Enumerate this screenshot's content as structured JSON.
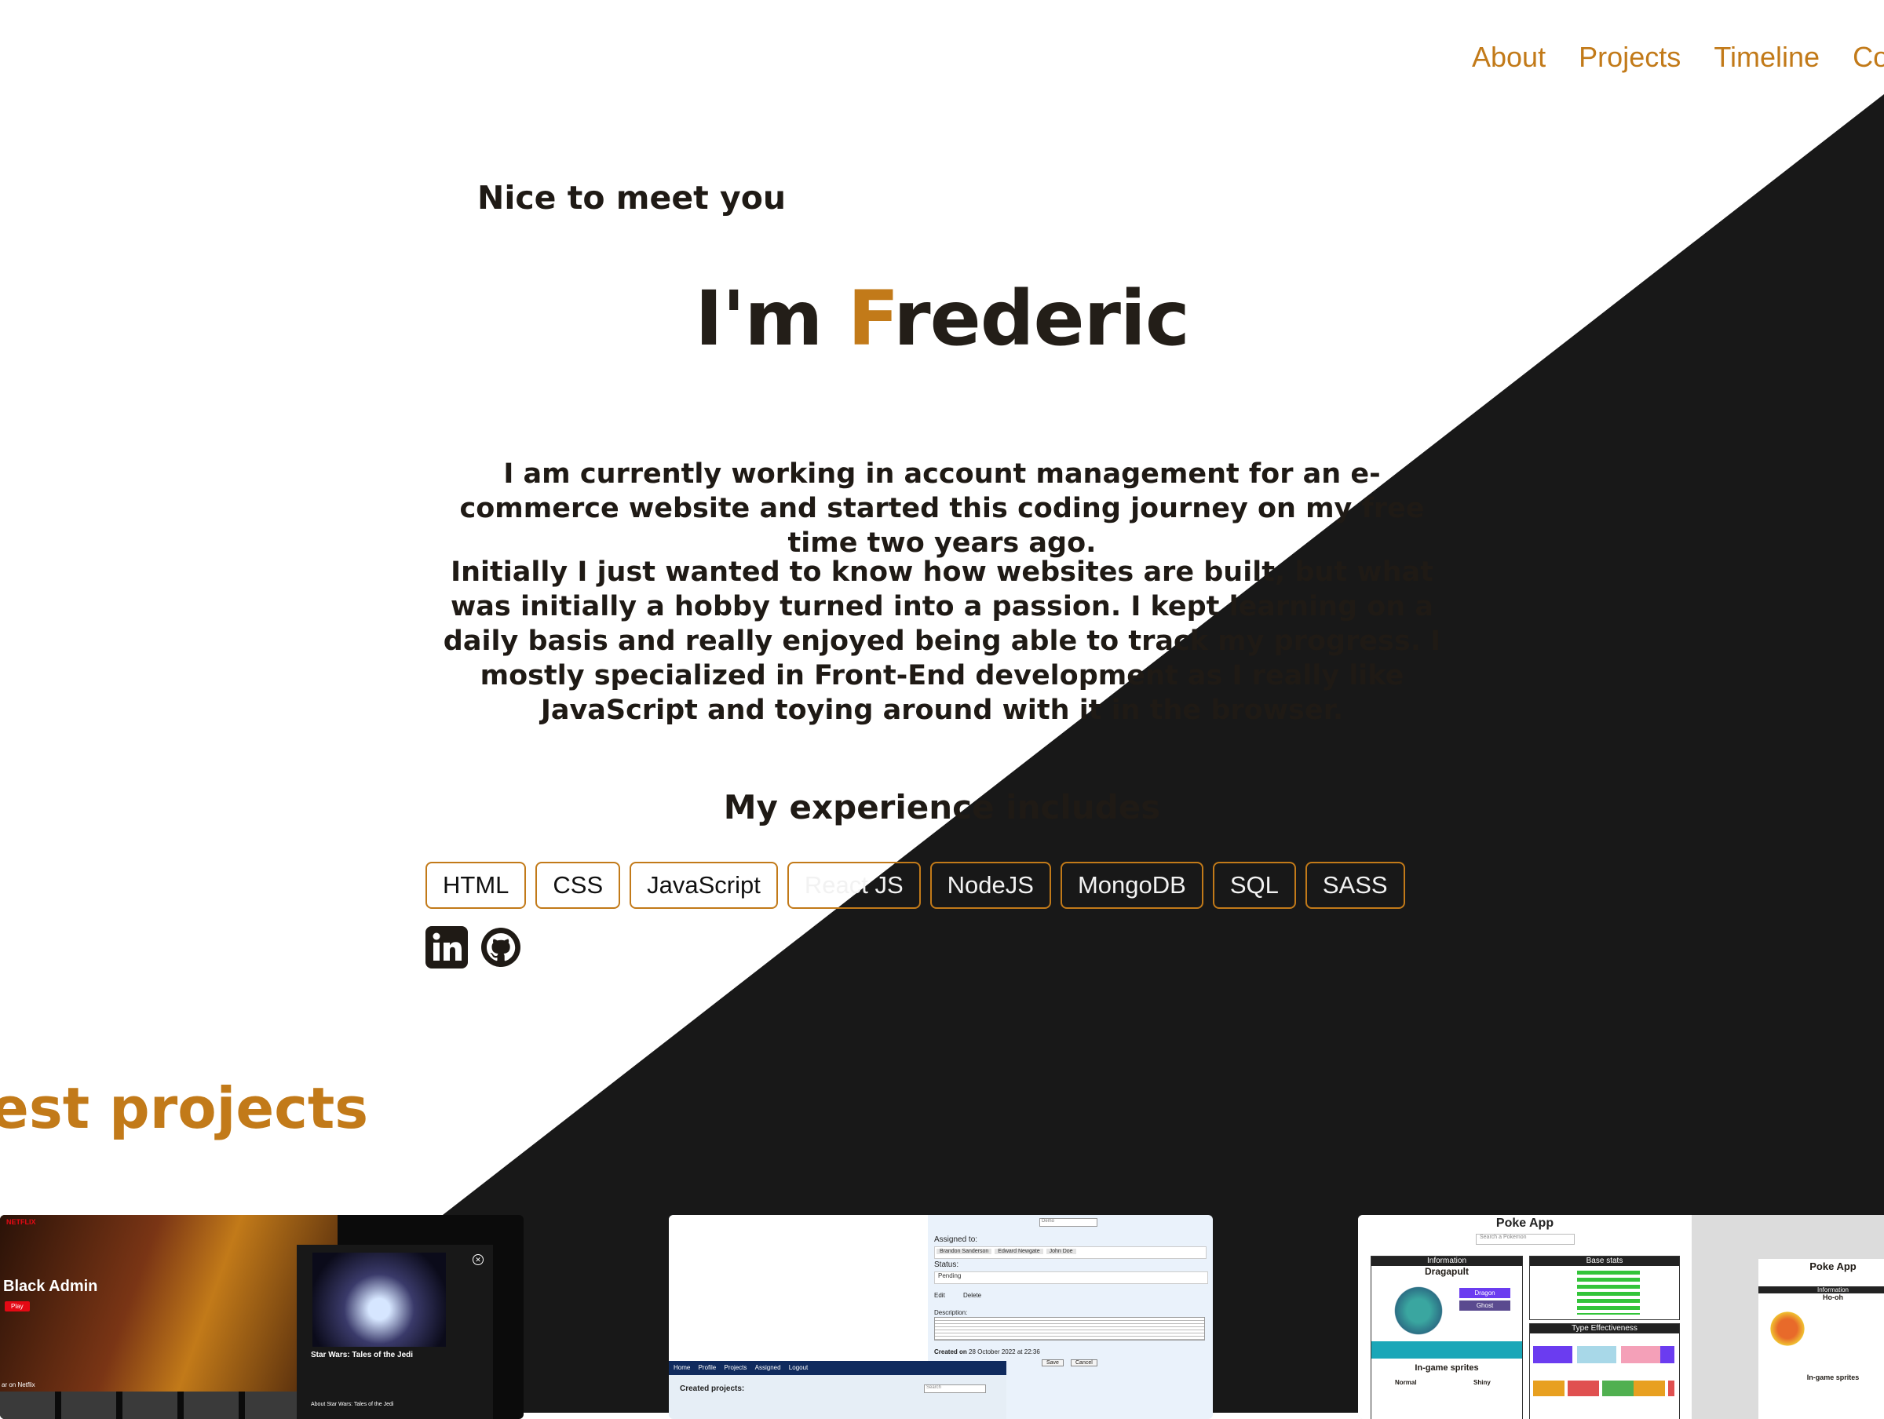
{
  "nav": {
    "items": [
      "About",
      "Projects",
      "Timeline",
      "Co"
    ]
  },
  "hero": {
    "greeting": "Nice to meet you",
    "title_prefix": "I'm ",
    "title_accent": "F",
    "title_rest": "rederic",
    "bio": [
      "I am currently working in account management for an e-commerce website and started this coding journey on my free time two years ago.",
      "Initially I just wanted to know how websites are built, but what was initially a hobby turned into a passion. I kept learning on a daily basis and really enjoyed being able to track my progress. I mostly specialized in Front-End development as I really like JavaScript and toying around with it in the browser."
    ]
  },
  "experience": {
    "heading": "My experience includes",
    "skills": [
      "HTML",
      "CSS",
      "JavaScript",
      "React JS",
      "NodeJS",
      "MongoDB",
      "SQL",
      "SASS"
    ]
  },
  "projects": {
    "heading": "est projects",
    "cards": [
      {
        "name": "netflix-clone",
        "title": "Black Admin",
        "subtitle": "Star Wars: Tales of the Jedi",
        "subtext": "About Star Wars: Tales of the Jedi",
        "button": "Play",
        "side_label": "ar on Netflix",
        "logo": "NETFLIX"
      },
      {
        "name": "project-tracker",
        "assigned_label": "Assigned to:",
        "assignees": [
          "Brandon Sanderson",
          "Edward Newgate",
          "John Doe"
        ],
        "status_label": "Status:",
        "status_value": "Pending",
        "edit": "Edit",
        "delete": "Delete",
        "description_label": "Description:",
        "created_prefix": "Created on",
        "created_date": "28 October 2022 at 22:36",
        "save": "Save",
        "cancel": "Cancel",
        "nav": [
          "Home",
          "Profile",
          "Projects",
          "Assigned",
          "Logout"
        ],
        "created_projects": "Created projects:",
        "search_placeholder": "Search",
        "demo_placeholder": "Demo"
      },
      {
        "name": "poke-app",
        "title": "Poke App",
        "search_placeholder": "Search a Pokemon",
        "info": "Information",
        "pokemon": "Dragapult",
        "base_stats": "Base stats",
        "effectiveness": "Type Effectiveness",
        "sprites": "In-game sprites",
        "normal": "Normal",
        "shiny": "Shiny",
        "types": [
          "Dragon",
          "Ghost"
        ],
        "second_title": "Poke App",
        "second_pokemon": "Ho-oh"
      }
    ]
  },
  "colors": {
    "accent": "#c27a19",
    "dark": "#181818",
    "light": "#ffffff"
  }
}
